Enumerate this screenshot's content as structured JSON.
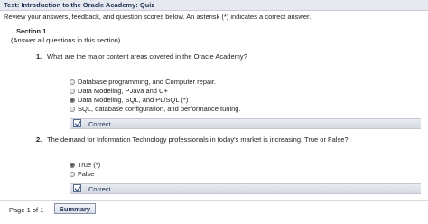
{
  "header": {
    "title": "Test: Introduction to the Oracle Academy: Quiz",
    "instructions": "Review your answers, feedback, and question scores below. An asterisk (*) indicates a correct answer."
  },
  "section": {
    "title": "Section 1",
    "note": "(Answer all questions in this section)"
  },
  "questions": [
    {
      "number": "1.",
      "text": "What are the major content areas covered in the Oracle Academy?",
      "options": [
        "Database programming, and Computer repair.",
        "Data Modeling, PJava and C+",
        "Data Modeling, SQL, and PL/SQL (*)",
        "SQL, database configuration, and performance tuning."
      ],
      "selected_index": 2,
      "feedback": "Correct"
    },
    {
      "number": "2.",
      "text": "The demand for Information Technology professionals in today's market is increasing. True or False?",
      "options": [
        "True (*)",
        "False"
      ],
      "selected_index": 0,
      "feedback": "Correct"
    }
  ],
  "footer": {
    "page_info": "Page 1 of 1",
    "summary_label": "Summary"
  },
  "icons": {
    "feedback": "check-icon",
    "option": "radio-icon"
  },
  "colors": {
    "header_bg": "#e6e9ef",
    "title_text": "#1f3152",
    "feedback_bg": "#dde1e9"
  }
}
